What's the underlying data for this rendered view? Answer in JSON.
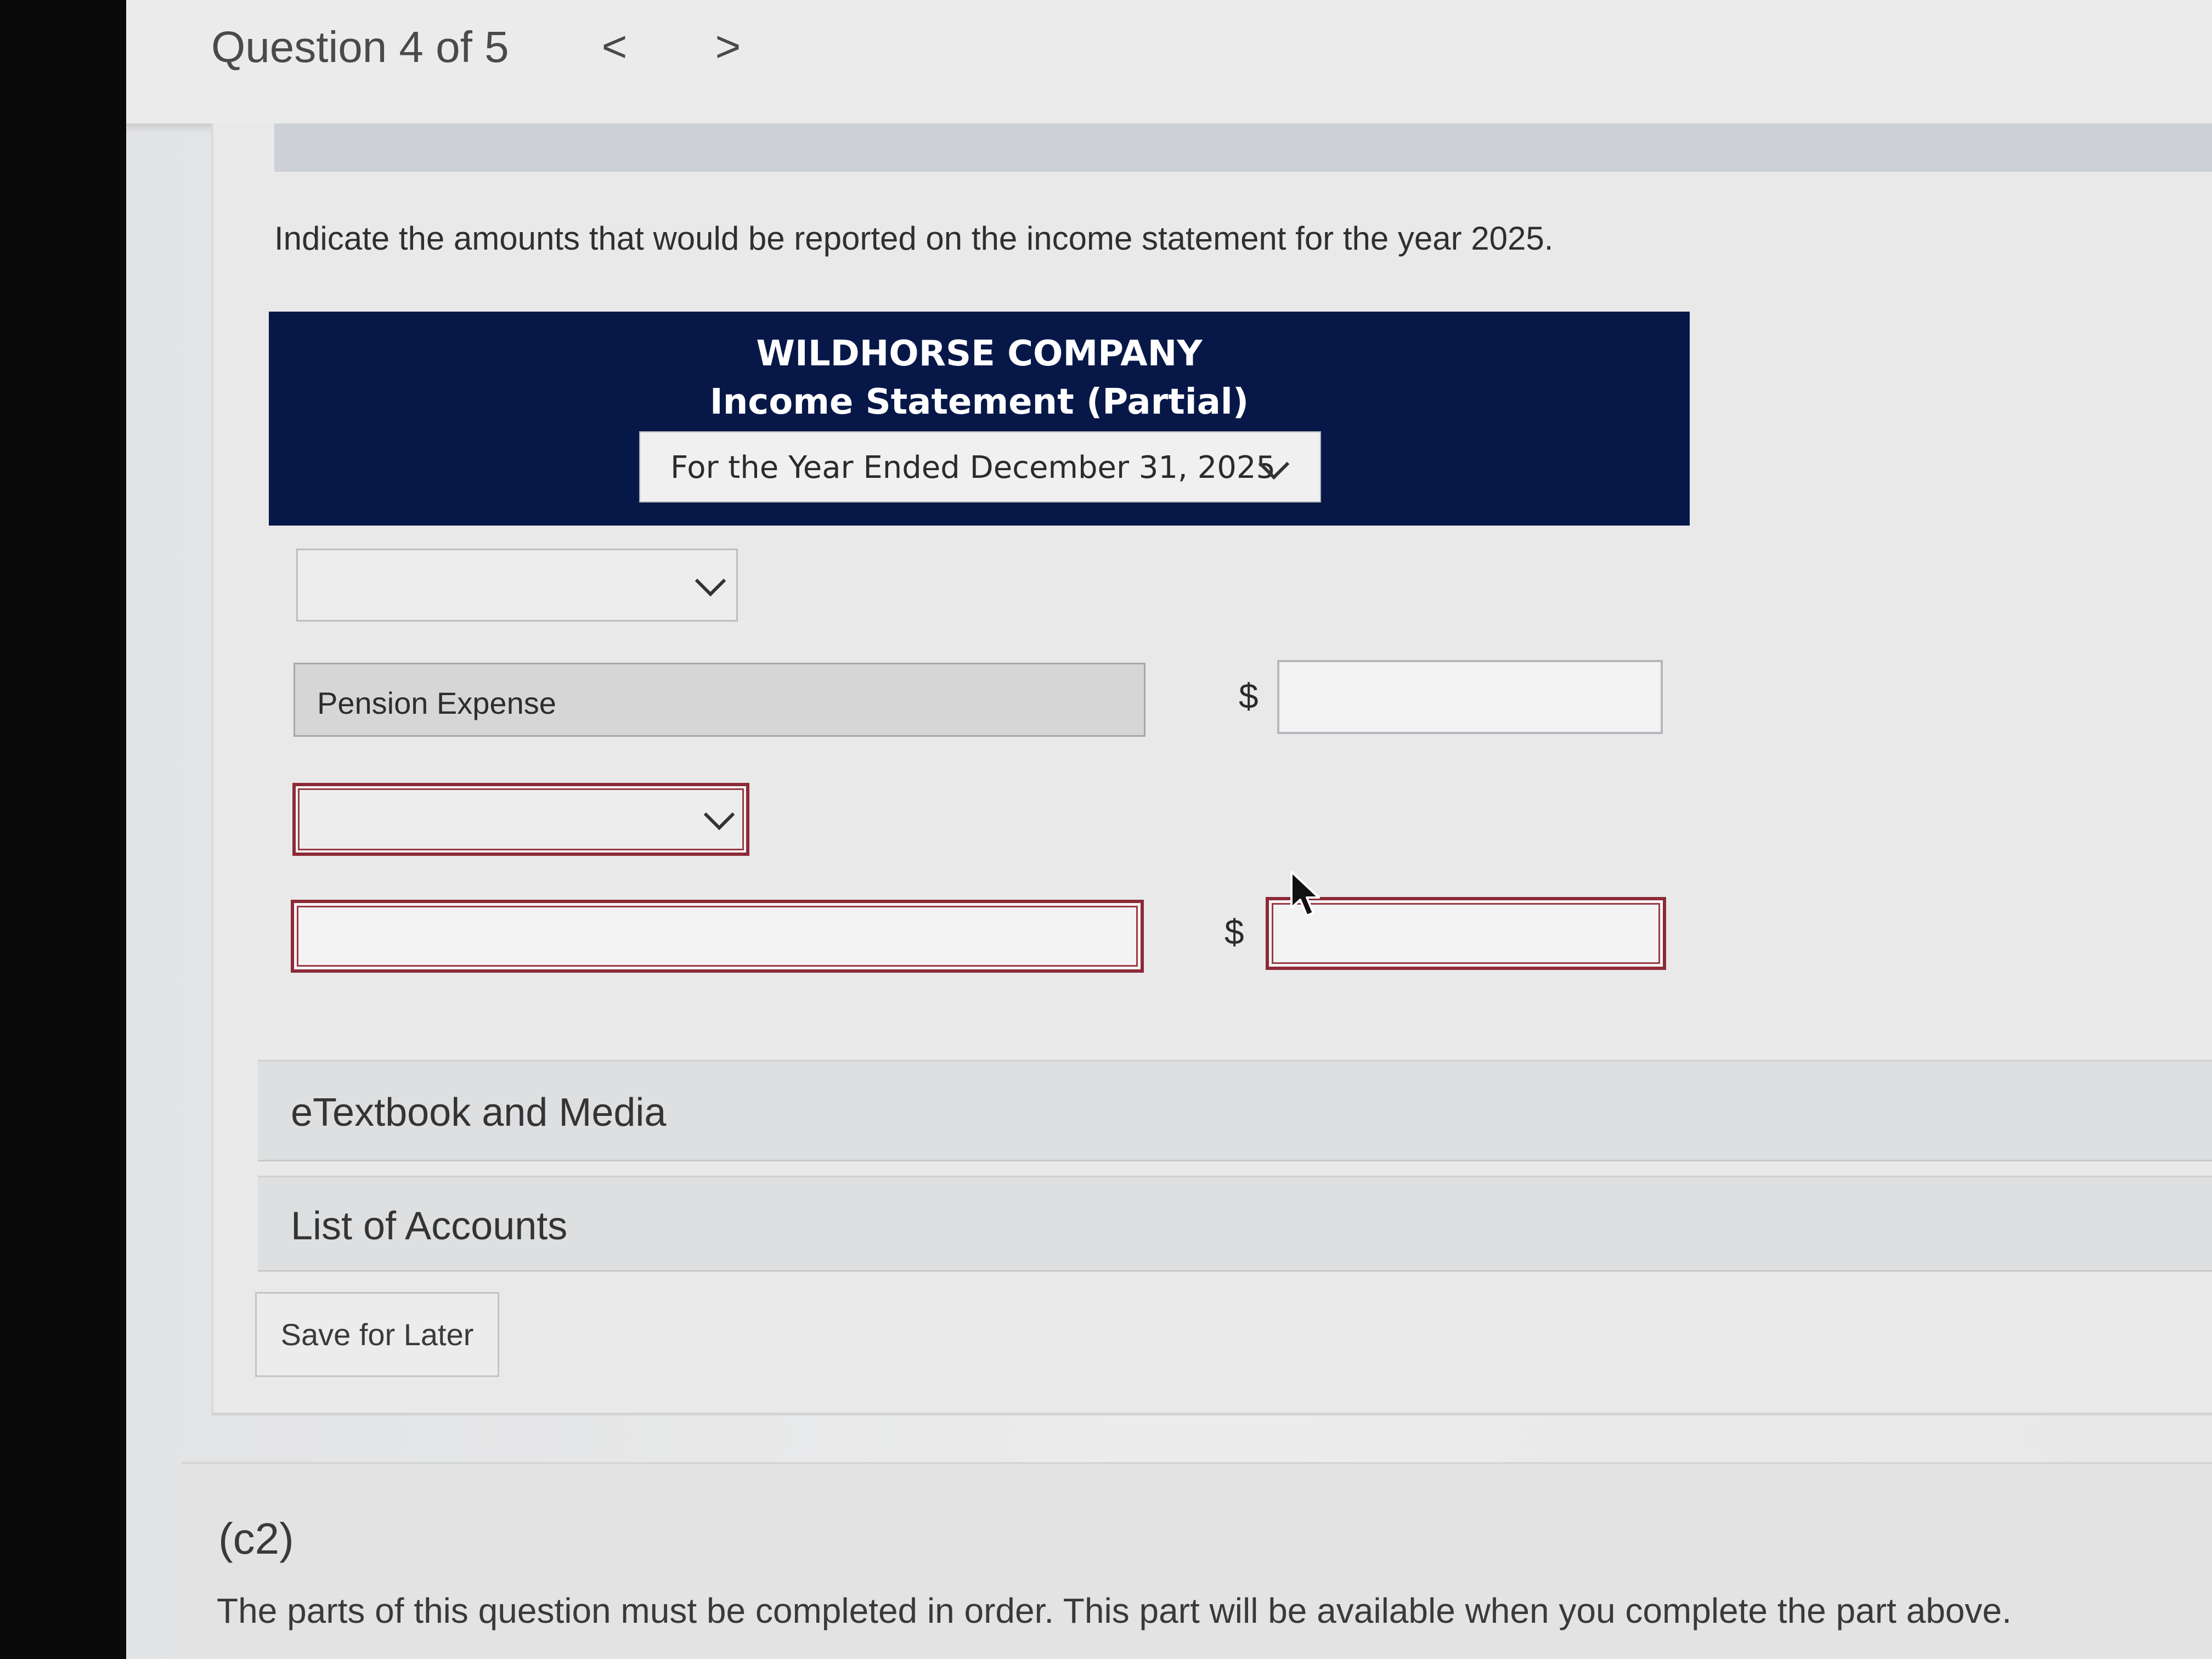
{
  "header": {
    "question_label": "Question 4 of 5",
    "prev_icon": "chevron-left-icon",
    "next_icon": "chevron-right-icon",
    "prev_glyph": "<",
    "next_glyph": ">"
  },
  "instruction": "Indicate the amounts that would be reported on the income statement for the year 2025.",
  "statement": {
    "company": "WILDHORSE COMPANY",
    "title": "Income Statement (Partial)",
    "period_selected": "For the Year Ended December 31, 2025"
  },
  "rows": [
    {
      "type": "select",
      "value": "",
      "status": "normal"
    },
    {
      "type": "line",
      "label": "Pension Expense",
      "currency": "$",
      "amount": ""
    },
    {
      "type": "select",
      "value": "",
      "status": "error"
    },
    {
      "type": "line",
      "label": "",
      "currency": "$",
      "amount": "",
      "status": "error"
    }
  ],
  "accordions": [
    {
      "label": "eTextbook and Media"
    },
    {
      "label": "List of Accounts"
    }
  ],
  "save_label": "Save for Later",
  "next_part": {
    "label": "(c2)",
    "message": "The parts of this question must be completed in order. This part will be available when you complete the part above."
  },
  "colors": {
    "header_bg": "#071848",
    "error_border": "#8c2a36"
  }
}
